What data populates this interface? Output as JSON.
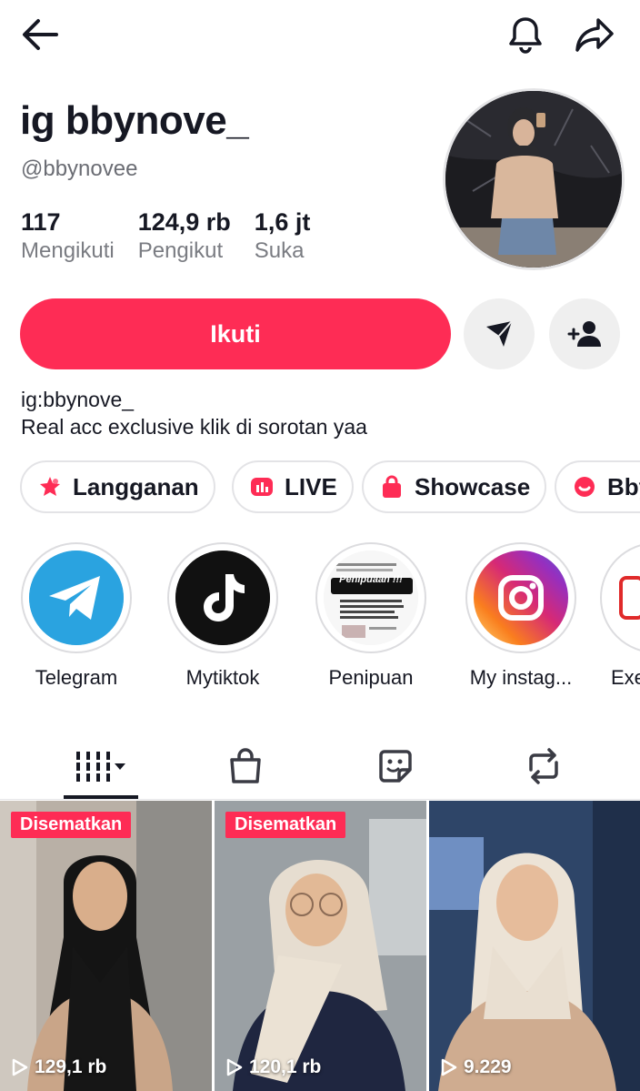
{
  "profile": {
    "name": "ig bbynove_",
    "handle": "@bbynovee",
    "stats": [
      {
        "value": "117",
        "label": "Mengikuti"
      },
      {
        "value": "124,9 rb",
        "label": "Pengikut"
      },
      {
        "value": "1,6 jt",
        "label": "Suka"
      }
    ],
    "follow_label": "Ikuti",
    "bio_line1": "ig:bbynove_",
    "bio_line2": "Real acc exclusive klik di sorotan yaa"
  },
  "chips": [
    {
      "label": "Langganan",
      "icon": "subscription-icon"
    },
    {
      "label": "LIVE",
      "icon": "live-icon"
    },
    {
      "label": "Showcase",
      "icon": "shopping-bag-icon"
    },
    {
      "label": "Bby",
      "icon": "chat-icon"
    }
  ],
  "highlights": [
    {
      "label": "Telegram",
      "icon": "telegram-icon",
      "badge": "Telegram"
    },
    {
      "label": "Mytiktok",
      "icon": "tiktok-icon"
    },
    {
      "label": "Penipuan",
      "icon": "penipuan-thumbnail",
      "badge": "Penipuaan !!!"
    },
    {
      "label": "My instag...",
      "icon": "instagram-icon"
    },
    {
      "label": "Exe",
      "icon": "highlight-thumbnail"
    }
  ],
  "tabs": [
    {
      "name": "videos",
      "icon": "grid-columns-icon"
    },
    {
      "name": "shop",
      "icon": "shopping-bag-icon"
    },
    {
      "name": "favorites",
      "icon": "sticker-icon"
    },
    {
      "name": "reposts",
      "icon": "repost-icon"
    }
  ],
  "videos": [
    {
      "pinned_label": "Disematkan",
      "views": "129,1 rb"
    },
    {
      "pinned_label": "Disematkan",
      "views": "120,1 rb"
    },
    {
      "pinned_label": "",
      "views": "9.229"
    }
  ],
  "colors": {
    "accent": "#fe2c55",
    "text": "#161823",
    "secondary_text": "#7a7c82"
  }
}
